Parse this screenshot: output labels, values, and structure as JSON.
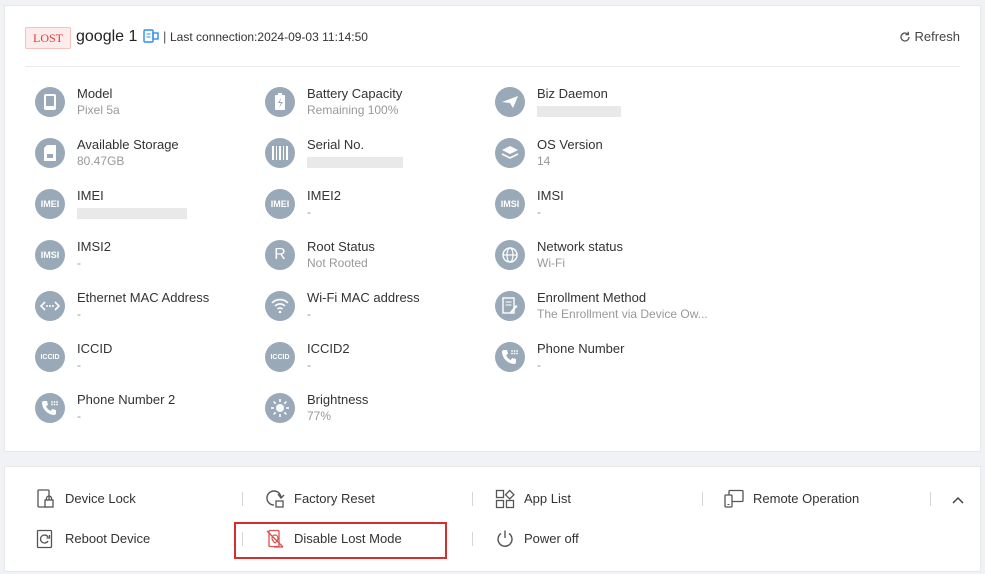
{
  "header": {
    "status_badge": "LOST",
    "device_name": "google 1",
    "separator": "|",
    "last_connection": "Last connection:2024-09-03 11:14:50",
    "refresh_label": "Refresh"
  },
  "info": [
    {
      "label": "Model",
      "value": "Pixel 5a",
      "icon": "phone-icon"
    },
    {
      "label": "Battery Capacity",
      "value": "Remaining 100%",
      "icon": "battery-icon"
    },
    {
      "label": "Biz Daemon",
      "value": "",
      "icon": "send-icon"
    },
    {
      "label": "Available Storage",
      "value": "80.47GB",
      "icon": "sd-card-icon"
    },
    {
      "label": "Serial No.",
      "value": "",
      "icon": "barcode-icon"
    },
    {
      "label": "OS Version",
      "value": "14",
      "icon": "layers-icon"
    },
    {
      "label": "IMEI",
      "value": "",
      "icon": "imei-icon",
      "icon_text": "IMEI"
    },
    {
      "label": "IMEI2",
      "value": "-",
      "icon": "imei2-icon",
      "icon_text": "IMEI"
    },
    {
      "label": "IMSI",
      "value": "-",
      "icon": "imsi-icon",
      "icon_text": "IMSI"
    },
    {
      "label": "IMSI2",
      "value": "-",
      "icon": "imsi2-icon",
      "icon_text": "IMSI"
    },
    {
      "label": "Root Status",
      "value": "Not Rooted",
      "icon": "root-icon",
      "icon_text": "R"
    },
    {
      "label": "Network status",
      "value": "Wi-Fi",
      "icon": "globe-icon"
    },
    {
      "label": "Ethernet MAC Address",
      "value": "-",
      "icon": "ethernet-icon"
    },
    {
      "label": "Wi-Fi MAC address",
      "value": "-",
      "icon": "wifi-icon"
    },
    {
      "label": "Enrollment Method",
      "value": "The Enrollment via Device Ow...",
      "icon": "document-edit-icon"
    },
    {
      "label": "ICCID",
      "value": "-",
      "icon": "iccid-icon",
      "icon_text": "ICCID"
    },
    {
      "label": "ICCID2",
      "value": "-",
      "icon": "iccid2-icon",
      "icon_text": "ICCID"
    },
    {
      "label": "Phone Number",
      "value": "-",
      "icon": "dialpad-icon"
    },
    {
      "label": "Phone Number 2",
      "value": "-",
      "icon": "dialpad2-icon"
    },
    {
      "label": "Brightness",
      "value": "77%",
      "icon": "sun-icon"
    }
  ],
  "actions": [
    {
      "label": "Device Lock",
      "icon": "device-lock-icon"
    },
    {
      "label": "Factory Reset",
      "icon": "factory-reset-icon"
    },
    {
      "label": "App List",
      "icon": "app-list-icon"
    },
    {
      "label": "Remote Operation",
      "icon": "remote-operation-icon"
    },
    {
      "label": "Reboot Device",
      "icon": "reboot-icon"
    },
    {
      "label": "Disable Lost Mode",
      "icon": "disable-lost-mode-icon"
    },
    {
      "label": "Power off",
      "icon": "power-icon"
    }
  ],
  "colors": {
    "accent_red": "#d32f2f",
    "badge_bg": "#fdecec",
    "icon_bg": "#9aa9b8"
  }
}
